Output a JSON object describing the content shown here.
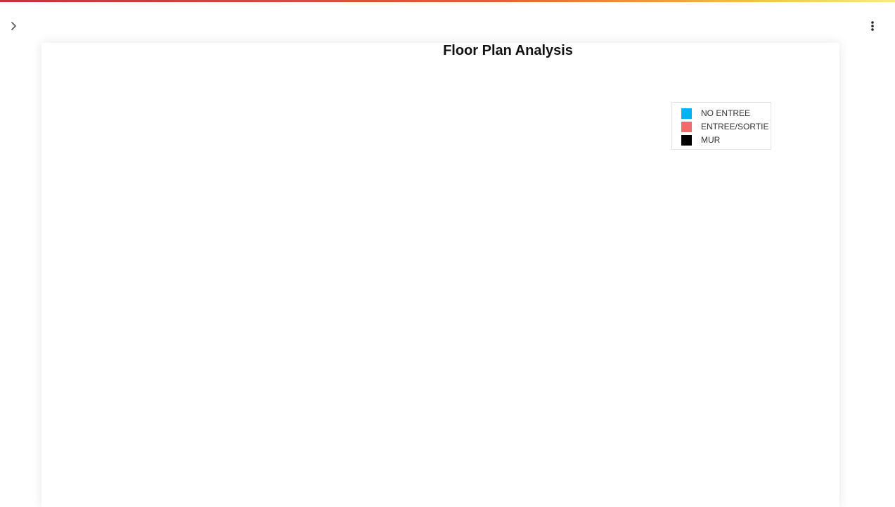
{
  "chart_data": {
    "type": "table",
    "title": "Floor Plan Analysis",
    "legend_placement": "top-right",
    "legend": [
      {
        "label": "NO ENTREE",
        "color": "#00b4f0"
      },
      {
        "label": "ENTREE/SORTIE",
        "color": "#f26a6a"
      },
      {
        "label": "MUR",
        "color": "#000000"
      }
    ]
  },
  "header": {
    "expand_icon": "chevron-right-icon",
    "menu_icon": "more-vertical-icon"
  }
}
